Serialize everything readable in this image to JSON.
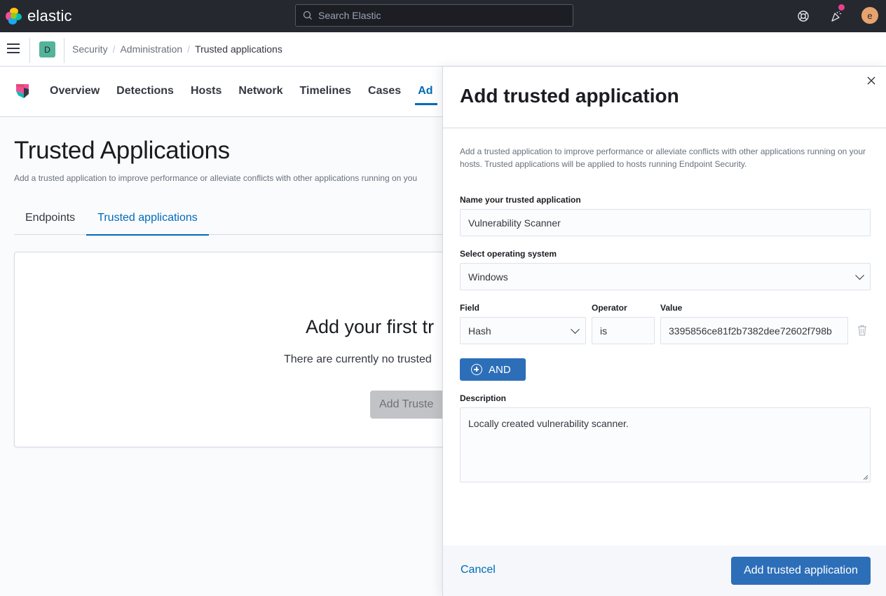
{
  "header": {
    "logo_text": "elastic",
    "search_placeholder": "Search Elastic",
    "user_initial": "e"
  },
  "breadcrumb": {
    "space_initial": "D",
    "items": [
      "Security",
      "Administration",
      "Trusted applications"
    ],
    "separator": "/"
  },
  "security_nav": {
    "tabs": [
      "Overview",
      "Detections",
      "Hosts",
      "Network",
      "Timelines",
      "Cases",
      "Ad"
    ],
    "active_tab": "Ad"
  },
  "page": {
    "title": "Trusted Applications",
    "description": "Add a trusted application to improve performance or alleviate conflicts with other applications running on you",
    "subtabs": [
      "Endpoints",
      "Trusted applications"
    ],
    "active_subtab": "Trusted applications",
    "empty_state": {
      "title": "Add your first tr",
      "text": "There are currently no trusted",
      "button": "Add Truste"
    }
  },
  "flyout": {
    "title": "Add trusted application",
    "description": "Add a trusted application to improve performance or alleviate conflicts with other applications running on your hosts. Trusted applications will be applied to hosts running Endpoint Security.",
    "name_label": "Name your trusted application",
    "name_value": "Vulnerability Scanner",
    "os_label": "Select operating system",
    "os_value": "Windows",
    "condition": {
      "field_label": "Field",
      "field_value": "Hash",
      "operator_label": "Operator",
      "operator_value": "is",
      "value_label": "Value",
      "value_value": "3395856ce81f2b7382dee72602f798b"
    },
    "and_button": "AND",
    "description_label": "Description",
    "description_value": "Locally created vulnerability scanner.",
    "cancel": "Cancel",
    "submit": "Add trusted application"
  },
  "colors": {
    "header_bg": "#25282f",
    "primary": "#2d6eb8",
    "link": "#006bb8",
    "notification_dot": "#e7408e",
    "avatar_bg": "#e7a36e",
    "space_badge_bg": "#54b399"
  }
}
